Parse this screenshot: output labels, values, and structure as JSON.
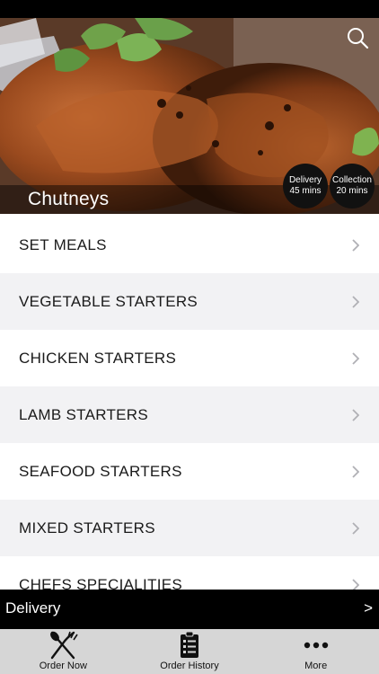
{
  "restaurant": {
    "name": "Chutneys"
  },
  "badges": {
    "delivery": {
      "title": "Delivery",
      "time": "45 mins"
    },
    "collection": {
      "title": "Collection",
      "time": "20 mins"
    }
  },
  "menu": {
    "items": [
      {
        "label": "SET MEALS"
      },
      {
        "label": "VEGETABLE STARTERS"
      },
      {
        "label": "CHICKEN STARTERS"
      },
      {
        "label": "LAMB STARTERS"
      },
      {
        "label": "SEAFOOD STARTERS"
      },
      {
        "label": "MIXED STARTERS"
      },
      {
        "label": "CHEFS SPECIALITIES"
      }
    ]
  },
  "order_bar": {
    "mode": "Delivery",
    "arrow": ">"
  },
  "tabs": [
    {
      "label": "Order Now",
      "icon": "fork-knife-icon"
    },
    {
      "label": "Order History",
      "icon": "clipboard-list-icon"
    },
    {
      "label": "More",
      "icon": "more-dots-icon"
    }
  ],
  "colors": {
    "status_bar": "#000000",
    "row_alt": "#f2f2f4",
    "tab_bar": "#d6d6d6",
    "badge": "#111111"
  }
}
